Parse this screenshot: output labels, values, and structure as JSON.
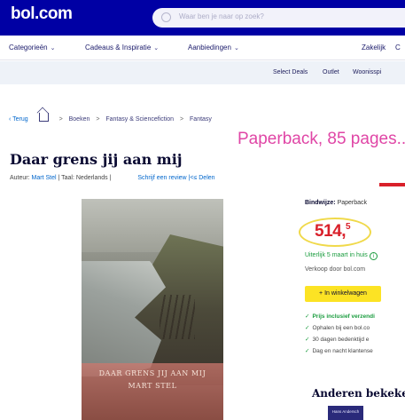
{
  "header": {
    "logo": "bol.com",
    "search_placeholder": "Waar ben je naar op zoek?"
  },
  "nav": {
    "items": [
      {
        "label": "Categorieën"
      },
      {
        "label": "Cadeaus & Inspiratie"
      },
      {
        "label": "Aanbiedingen"
      }
    ],
    "right": [
      "Zakelijk",
      "C"
    ]
  },
  "subnav": {
    "items": [
      "Select Deals",
      "Outlet",
      "Woonisspi"
    ]
  },
  "breadcrumb": {
    "back": "Terug",
    "items": [
      "Boeken",
      "Fantasy & Sciencefiction",
      "Fantasy"
    ]
  },
  "annotation": "Paperback, 85 pages...",
  "product": {
    "title": "Daar grens jij aan mij",
    "author_prefix": "Auteur:",
    "author": "Mart Stel",
    "language": "| Taal: Nederlands |",
    "review_link": "Schrijf een review",
    "share": "|<≤ Delen",
    "cover_title": "DAAR GRENS JIJ AAN MIJ",
    "cover_author": "MART STEL"
  },
  "buybox": {
    "binding_label": "Bindwijze:",
    "binding_value": "Paperback",
    "price_main": "514,",
    "price_cents": "5",
    "delivery": "Uiterlijk 5 maart in huis",
    "seller": "Verkoop door bol.com",
    "cart_button": "+ In winkelwagen",
    "bullets": [
      "Prijs inclusief verzendi",
      "Ophalen bij een bol.co",
      "30 dagen bedenktijd e",
      "Dag en nacht klantense"
    ]
  },
  "also_viewed": {
    "title": "Anderen bekeken",
    "thumb_label": "Hans Andersch"
  },
  "colors": {
    "brand_blue": "#0000a4",
    "price_red": "#d9202a",
    "cart_yellow": "#fce324",
    "annotation_pink": "#e046a6",
    "highlight_circle": "#f0d94a",
    "success_green": "#1a9c3e"
  }
}
